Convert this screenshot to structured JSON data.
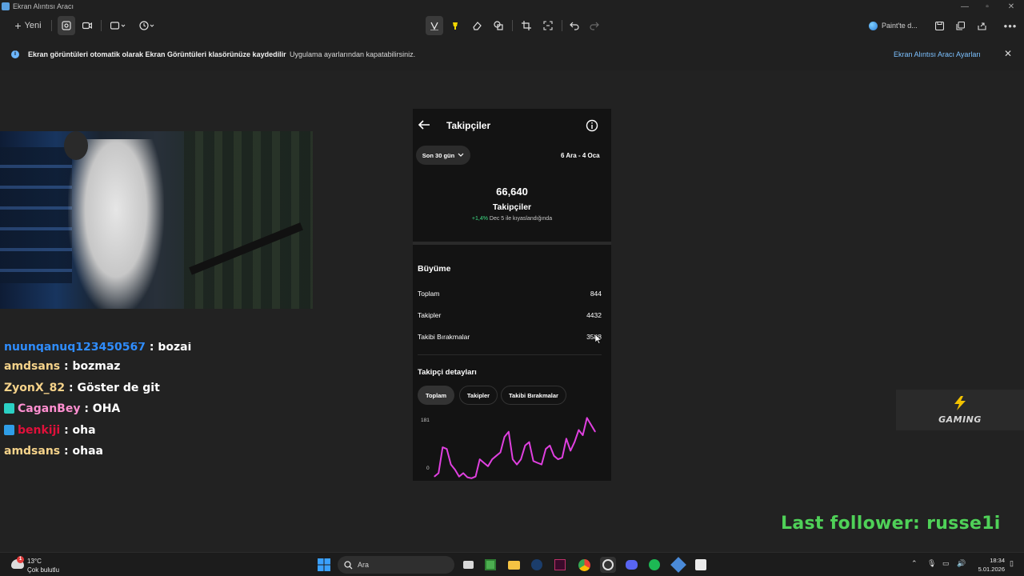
{
  "window": {
    "title": "Ekran Alıntısı Aracı"
  },
  "toolbar": {
    "new_label": "Yeni",
    "paint_label": "Paint'te d..."
  },
  "infobar": {
    "bold_text": "Ekran görüntüleri otomatik olarak Ekran Görüntüleri klasörünüze kaydedilir",
    "regular_text": "Uygulama ayarlarından kapatabilirsiniz.",
    "link_text": "Ekran Alıntısı Aracı Ayarları"
  },
  "chat": {
    "lines": [
      {
        "user": "nuunqanuq123450567",
        "message": " : bozai",
        "user_color": "#2f8dff",
        "badge": null
      },
      {
        "user": "amdsans",
        "message": " : bozmaz",
        "user_color": "#f6d38a",
        "badge": null
      },
      {
        "user": "ZyonX_82",
        "message": " : Göster de git",
        "user_color": "#f6d38a",
        "badge": null
      },
      {
        "user": "CaganBey",
        "message": " : OHA",
        "user_color": "#ff8fd0",
        "badge": "#2bd0c4"
      },
      {
        "user": "benkiji",
        "message": " : oha",
        "user_color": "#e0103a",
        "badge": "#2f9ee8"
      },
      {
        "user": "amdsans",
        "message": " : ohaa",
        "user_color": "#f6d38a",
        "badge": null
      }
    ]
  },
  "phone": {
    "header_title": "Takipçiler",
    "period_label": "Son 30 gün",
    "date_range": "6 Ara - 4 Oca",
    "total_followers": "66,640",
    "total_label": "Takipçiler",
    "change_value": "+1,4%",
    "change_text": " Dec 5 ile kıyaslandığında",
    "growth": {
      "title": "Büyüme",
      "rows": [
        {
          "label": "Toplam",
          "value": "844"
        },
        {
          "label": "Takipler",
          "value": "4432"
        },
        {
          "label": "Takibi Bırakmalar",
          "value": "3588"
        }
      ]
    },
    "details": {
      "title": "Takipçi detayları",
      "tabs": [
        "Toplam",
        "Takipler",
        "Takibi Bırakmalar"
      ],
      "active_tab": "Toplam"
    },
    "chart_data": {
      "type": "line",
      "y_max_label": "181",
      "y_min_label": "0",
      "ylim": [
        0,
        181
      ],
      "color": "#e040e0",
      "values": [
        10,
        20,
        95,
        90,
        45,
        30,
        10,
        20,
        8,
        5,
        10,
        60,
        50,
        40,
        60,
        70,
        80,
        125,
        140,
        60,
        45,
        60,
        100,
        110,
        55,
        50,
        45,
        90,
        100,
        70,
        60,
        65,
        120,
        85,
        110,
        145,
        130,
        180,
        160,
        140
      ]
    }
  },
  "overlay": {
    "logo_text": "GAMING",
    "last_follower": "Last follower: russe1i"
  },
  "taskbar": {
    "weather_temp": "13°C",
    "weather_desc": "Çok bulutlu",
    "weather_badge": "1",
    "search_label": "Ara",
    "time": "18:34",
    "date": "5.01.2026"
  }
}
